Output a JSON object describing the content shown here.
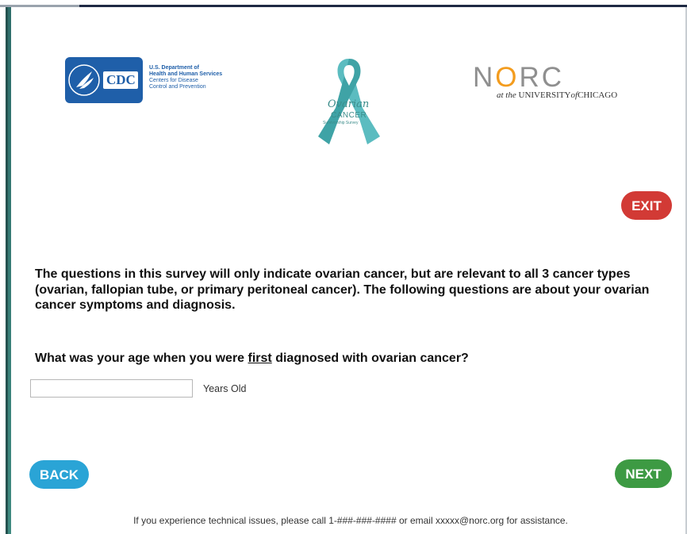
{
  "logos": {
    "cdc": {
      "box_text": "CDC",
      "line1": "U.S. Department of",
      "line2": "Health and Human Services",
      "line3": "Centers for Disease",
      "line4": "Control and Prevention",
      "color": "#1f5fa9"
    },
    "ribbon": {
      "title": "Ovarian",
      "subtitle": "CANCER",
      "tagline": "Survivorship Survey",
      "color": "#3b8c8a"
    },
    "norc": {
      "letter_n": "N",
      "letter_o": "O",
      "letters_rc": "RC",
      "at_the": "at the",
      "university": "UNIVERSITY",
      "of": "of",
      "chicago": "CHICAGO",
      "accent": "#f39c1e"
    }
  },
  "buttons": {
    "exit": "EXIT",
    "back": "BACK",
    "next": "NEXT"
  },
  "colors": {
    "exit": "#d23a35",
    "back": "#2aa4d6",
    "next": "#3d9a43"
  },
  "intro_text": "The questions in this survey will only indicate ovarian cancer, but are relevant to all 3 cancer types (ovarian, fallopian tube, or primary peritoneal cancer). The following questions are about your ovarian cancer symptoms and diagnosis.",
  "question": {
    "before": "What was your age when you were ",
    "emphasis": "first",
    "after": " diagnosed with ovarian cancer?"
  },
  "age_input": {
    "value": "",
    "unit_label": "Years Old"
  },
  "footer": "If you experience technical issues, please call 1-###-###-#### or email xxxxx@norc.org for assistance."
}
